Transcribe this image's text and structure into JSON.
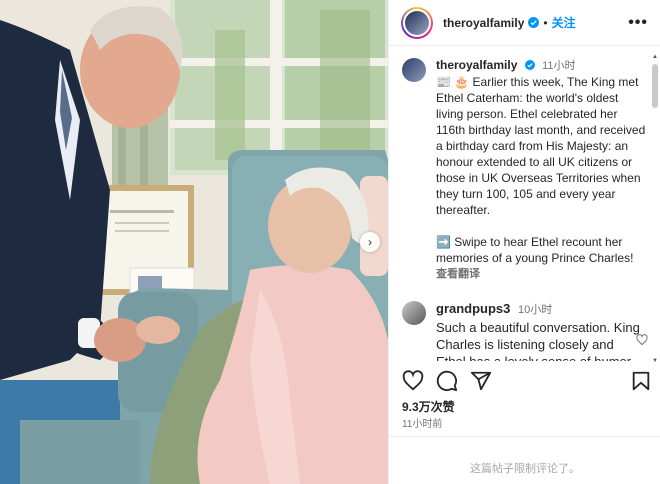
{
  "post": {
    "username": "theroyalfamily",
    "follow_label": "关注",
    "separator": "•",
    "more_label": "•••",
    "carousel_next": "›"
  },
  "caption": {
    "username": "theroyalfamily",
    "time": "11小时",
    "text": "📰 🎂 Earlier this week, The King met Ethel Caterham: the world's oldest living person. Ethel celebrated her 116th birthday last month, and received a birthday card from His Majesty: an honour extended to all UK citizens or those in UK Overseas Territories when they turn 100, 105 and every year thereafter.",
    "text2": "➡️ Swipe to hear Ethel recount her memories of a young Prince Charles!",
    "translate_label": "查看翻译"
  },
  "comment": {
    "username": "grandpups3",
    "time": "10小时",
    "text": "Such a beautiful conversation. King Charles is listening closely and Ethel has a lovely sense of humor."
  },
  "stats": {
    "likes": "9.3万次赞",
    "posted": "11小时前"
  },
  "footer": {
    "limited": "这篇帖子限制评论了。"
  },
  "icons": {
    "like": "heart-icon",
    "comment": "comment-icon",
    "share": "share-icon",
    "save": "bookmark-icon",
    "verified": "verified-badge-icon"
  },
  "colors": {
    "accent": "#0095f6",
    "secondary_text": "#737373",
    "verified": "#0095f6"
  }
}
